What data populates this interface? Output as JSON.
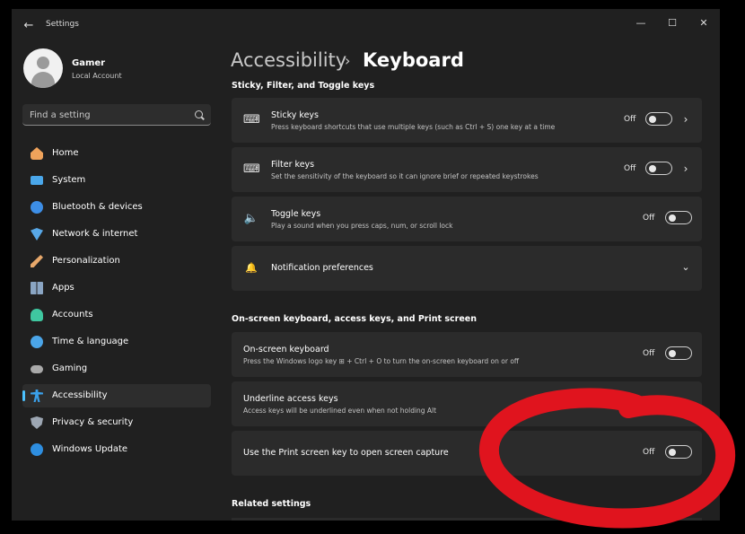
{
  "window": {
    "app_title": "Settings",
    "back_glyph": "←",
    "controls": [
      {
        "name": "minimize-button",
        "glyph": "—"
      },
      {
        "name": "maximize-button",
        "glyph": "☐"
      },
      {
        "name": "close-button",
        "glyph": "✕"
      }
    ]
  },
  "profile": {
    "name": "Gamer",
    "account_type": "Local Account"
  },
  "search": {
    "placeholder": "Find a setting",
    "value": "",
    "icon": "search-icon"
  },
  "nav": {
    "items": [
      {
        "label": "Home",
        "icon": "home-icon",
        "color": "#f0a35b",
        "active": false
      },
      {
        "label": "System",
        "icon": "monitor-icon",
        "color": "#4aa7ea",
        "active": false
      },
      {
        "label": "Bluetooth & devices",
        "icon": "bluetooth-icon",
        "color": "#3d8ee6",
        "active": false
      },
      {
        "label": "Network & internet",
        "icon": "wifi-icon",
        "color": "#58a8e8",
        "active": false
      },
      {
        "label": "Personalization",
        "icon": "brush-icon",
        "color": "#e7a86b",
        "active": false
      },
      {
        "label": "Apps",
        "icon": "apps-icon",
        "color": "#8aa5c3",
        "active": false
      },
      {
        "label": "Accounts",
        "icon": "person-icon",
        "color": "#3fc7a0",
        "active": false
      },
      {
        "label": "Time & language",
        "icon": "globe-clock-icon",
        "color": "#4ba5e8",
        "active": false
      },
      {
        "label": "Gaming",
        "icon": "gamepad-icon",
        "color": "#a9a9a9",
        "active": false
      },
      {
        "label": "Accessibility",
        "icon": "accessibility-icon",
        "color": "#3aa0ea",
        "active": true
      },
      {
        "label": "Privacy & security",
        "icon": "shield-icon",
        "color": "#9da7b3",
        "active": false
      },
      {
        "label": "Windows Update",
        "icon": "update-icon",
        "color": "#2e8ee0",
        "active": false
      }
    ]
  },
  "breadcrumb": {
    "parent": "Accessibility",
    "separator": "›",
    "current": "Keyboard"
  },
  "sections": [
    {
      "title": "Sticky, Filter, and Toggle keys",
      "cards": [
        {
          "title": "Sticky keys",
          "description": "Press keyboard shortcuts that use multiple keys (such as Ctrl + S) one key at a time",
          "state": "Off",
          "icon": "sticky-keys-icon",
          "icon_glyph": "⌨",
          "has_toggle": true,
          "has_chevron": true
        },
        {
          "title": "Filter keys",
          "description": "Set the sensitivity of the keyboard so it can ignore brief or repeated keystrokes",
          "state": "Off",
          "icon": "filter-keys-icon",
          "icon_glyph": "⌨",
          "has_toggle": true,
          "has_chevron": true
        },
        {
          "title": "Toggle keys",
          "description": "Play a sound when you press caps, num, or scroll lock",
          "state": "Off",
          "icon": "speaker-icon",
          "icon_glyph": "🔈",
          "has_toggle": true,
          "has_chevron": false
        },
        {
          "title": "Notification preferences",
          "description": "",
          "state": "",
          "icon": "bell-icon",
          "icon_glyph": "🔔",
          "has_toggle": false,
          "has_chevron": false,
          "expandable": true
        }
      ]
    },
    {
      "title": "On-screen keyboard, access keys, and Print screen",
      "cards": [
        {
          "title": "On-screen keyboard",
          "description": "Press the Windows logo key ⊞ + Ctrl + O to turn the on-screen keyboard on or off",
          "state": "Off",
          "has_toggle": true
        },
        {
          "title": "Underline access keys",
          "description": "Access keys will be underlined even when not holding Alt",
          "state": "",
          "has_toggle": false
        },
        {
          "title": "Use the Print screen key to open screen capture",
          "description": "",
          "state": "Off",
          "has_toggle": true
        }
      ]
    },
    {
      "title": "Related settings",
      "cards": []
    }
  ],
  "glyphs": {
    "chevron_right": "›",
    "chevron_down": "⌄"
  },
  "colors": {
    "accent": "#4cc2ff",
    "annotation": "#e0141e"
  }
}
